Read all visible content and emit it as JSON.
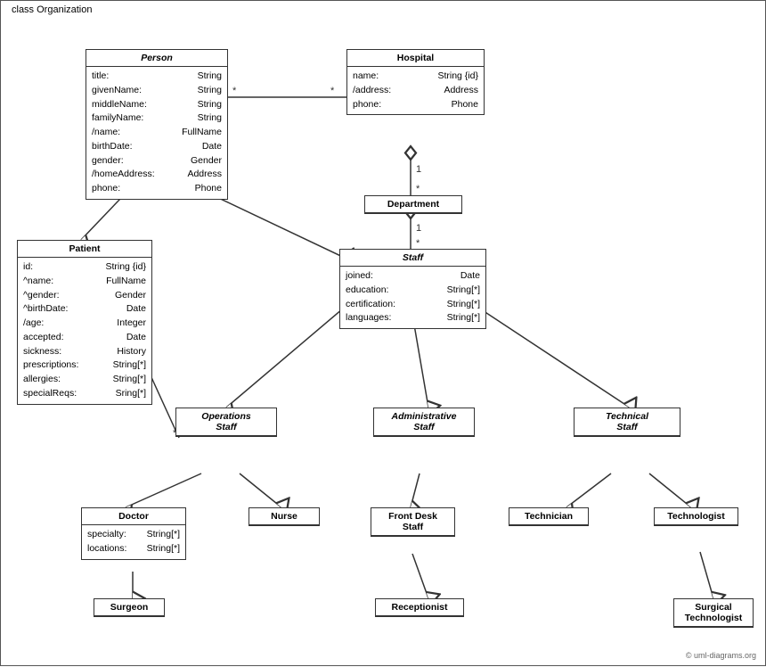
{
  "diagram": {
    "title": "class Organization",
    "copyright": "© uml-diagrams.org",
    "classes": {
      "person": {
        "name": "Person",
        "italic": true,
        "attrs": [
          {
            "name": "title:",
            "type": "String"
          },
          {
            "name": "givenName:",
            "type": "String"
          },
          {
            "name": "middleName:",
            "type": "String"
          },
          {
            "name": "familyName:",
            "type": "String"
          },
          {
            "name": "/name:",
            "type": "FullName"
          },
          {
            "name": "birthDate:",
            "type": "Date"
          },
          {
            "name": "gender:",
            "type": "Gender"
          },
          {
            "name": "/homeAddress:",
            "type": "Address"
          },
          {
            "name": "phone:",
            "type": "Phone"
          }
        ]
      },
      "hospital": {
        "name": "Hospital",
        "italic": false,
        "attrs": [
          {
            "name": "name:",
            "type": "String {id}"
          },
          {
            "name": "/address:",
            "type": "Address"
          },
          {
            "name": "phone:",
            "type": "Phone"
          }
        ]
      },
      "department": {
        "name": "Department",
        "italic": false,
        "attrs": []
      },
      "staff": {
        "name": "Staff",
        "italic": true,
        "attrs": [
          {
            "name": "joined:",
            "type": "Date"
          },
          {
            "name": "education:",
            "type": "String[*]"
          },
          {
            "name": "certification:",
            "type": "String[*]"
          },
          {
            "name": "languages:",
            "type": "String[*]"
          }
        ]
      },
      "patient": {
        "name": "Patient",
        "italic": false,
        "attrs": [
          {
            "name": "id:",
            "type": "String {id}"
          },
          {
            "name": "^name:",
            "type": "FullName"
          },
          {
            "name": "^gender:",
            "type": "Gender"
          },
          {
            "name": "^birthDate:",
            "type": "Date"
          },
          {
            "name": "/age:",
            "type": "Integer"
          },
          {
            "name": "accepted:",
            "type": "Date"
          },
          {
            "name": "sickness:",
            "type": "History"
          },
          {
            "name": "prescriptions:",
            "type": "String[*]"
          },
          {
            "name": "allergies:",
            "type": "String[*]"
          },
          {
            "name": "specialReqs:",
            "type": "Sring[*]"
          }
        ]
      },
      "operations_staff": {
        "name": "Operations Staff",
        "italic": true
      },
      "administrative_staff": {
        "name": "Administrative Staff",
        "italic": true
      },
      "technical_staff": {
        "name": "Technical Staff",
        "italic": true
      },
      "doctor": {
        "name": "Doctor",
        "italic": false,
        "attrs": [
          {
            "name": "specialty:",
            "type": "String[*]"
          },
          {
            "name": "locations:",
            "type": "String[*]"
          }
        ]
      },
      "nurse": {
        "name": "Nurse",
        "italic": false,
        "attrs": []
      },
      "front_desk_staff": {
        "name": "Front Desk Staff",
        "italic": false,
        "attrs": []
      },
      "technician": {
        "name": "Technician",
        "italic": false,
        "attrs": []
      },
      "technologist": {
        "name": "Technologist",
        "italic": false,
        "attrs": []
      },
      "surgeon": {
        "name": "Surgeon",
        "italic": false,
        "attrs": []
      },
      "receptionist": {
        "name": "Receptionist",
        "italic": false,
        "attrs": []
      },
      "surgical_technologist": {
        "name": "Surgical Technologist",
        "italic": false,
        "attrs": []
      }
    }
  }
}
